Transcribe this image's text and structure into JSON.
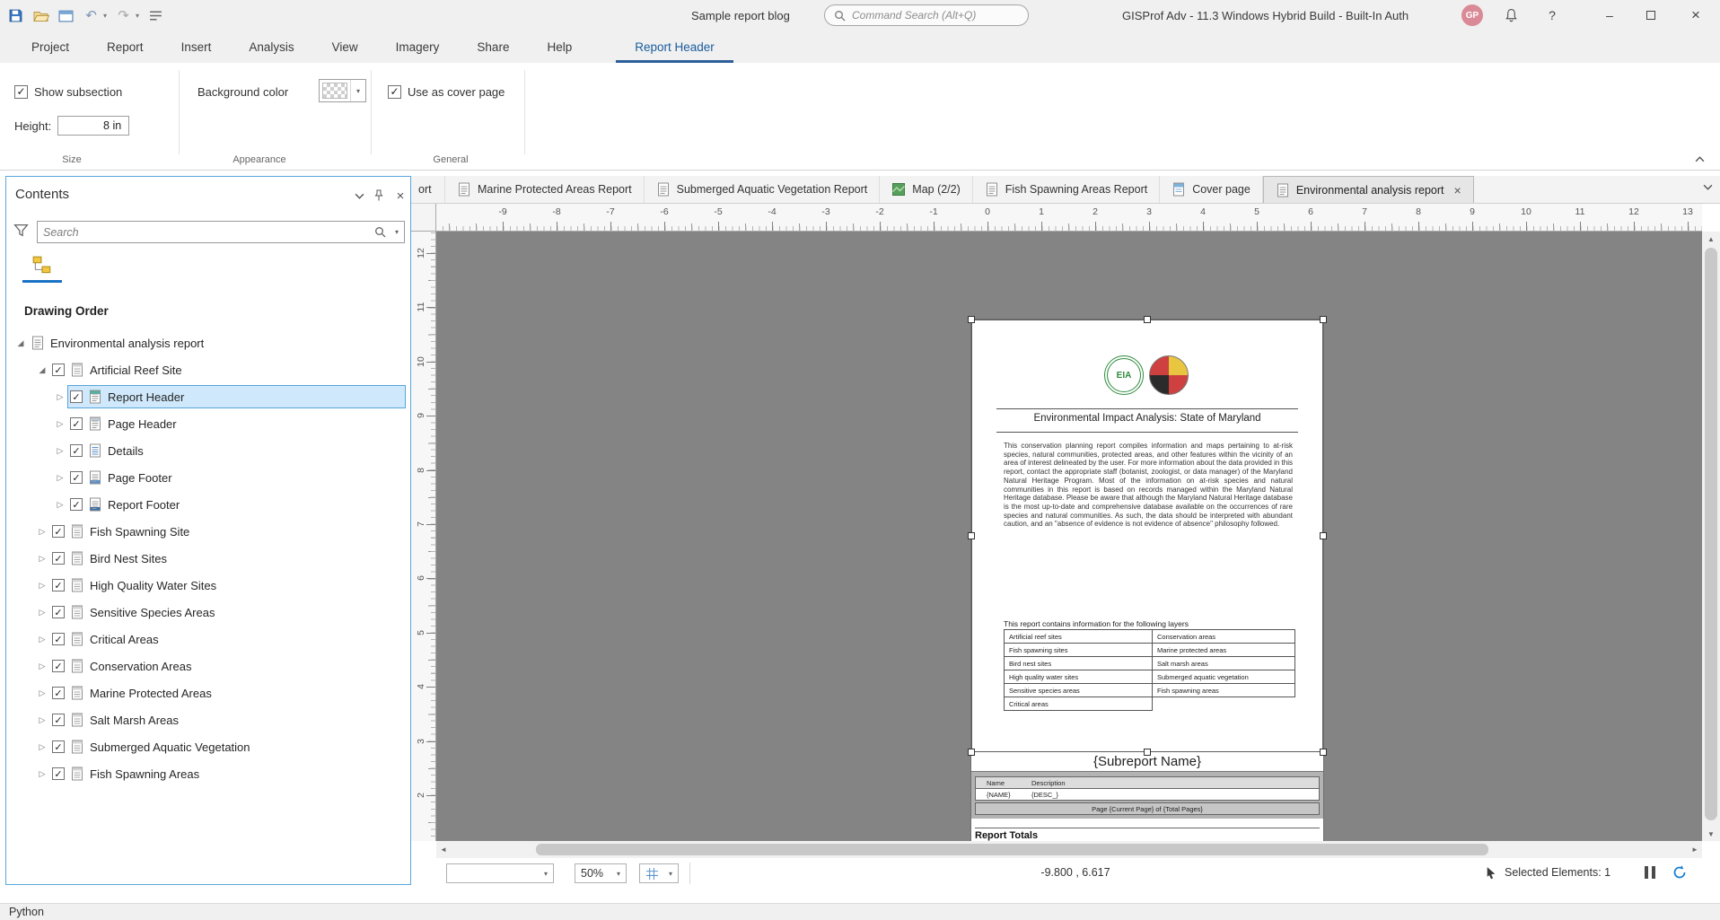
{
  "titlebar": {
    "project_name": "Sample report blog",
    "search_placeholder": "Command Search (Alt+Q)",
    "app_title": "GISProf Adv - 11.3 Windows Hybrid Build - Built-In Auth",
    "avatar_initials": "GP"
  },
  "ribbon": {
    "tabs": [
      "Project",
      "Report",
      "Insert",
      "Analysis",
      "View",
      "Imagery",
      "Share",
      "Help"
    ],
    "contextual_tab": "Report Header",
    "size_group": {
      "show_subsection_label": "Show subsection",
      "height_label": "Height:",
      "height_value": "8 in",
      "group_label": "Size"
    },
    "appearance_group": {
      "background_color_label": "Background color",
      "group_label": "Appearance"
    },
    "general_group": {
      "use_as_cover_label": "Use as cover page",
      "group_label": "General"
    }
  },
  "contents_panel": {
    "title": "Contents",
    "search_placeholder": "Search",
    "section_title": "Drawing Order",
    "tree": [
      {
        "label": "Environmental analysis report",
        "level": 0,
        "expander": "expanded",
        "checked": null,
        "icon": "report",
        "selected": false
      },
      {
        "label": "Artificial Reef Site",
        "level": 1,
        "expander": "expanded",
        "checked": true,
        "icon": "section",
        "selected": false
      },
      {
        "label": "Report Header",
        "level": 2,
        "expander": "collapsed",
        "checked": true,
        "icon": "report-header",
        "selected": true
      },
      {
        "label": "Page Header",
        "level": 2,
        "expander": "collapsed",
        "checked": true,
        "icon": "page-header",
        "selected": false
      },
      {
        "label": "Details",
        "level": 2,
        "expander": "collapsed",
        "checked": true,
        "icon": "details",
        "selected": false
      },
      {
        "label": "Page Footer",
        "level": 2,
        "expander": "collapsed",
        "checked": true,
        "icon": "page-footer",
        "selected": false
      },
      {
        "label": "Report Footer",
        "level": 2,
        "expander": "collapsed",
        "checked": true,
        "icon": "report-footer",
        "selected": false
      },
      {
        "label": "Fish Spawning Site",
        "level": 1,
        "expander": "collapsed",
        "checked": true,
        "icon": "section",
        "selected": false
      },
      {
        "label": "Bird Nest Sites",
        "level": 1,
        "expander": "collapsed",
        "checked": true,
        "icon": "section",
        "selected": false
      },
      {
        "label": "High Quality Water Sites",
        "level": 1,
        "expander": "collapsed",
        "checked": true,
        "icon": "section",
        "selected": false
      },
      {
        "label": "Sensitive Species Areas",
        "level": 1,
        "expander": "collapsed",
        "checked": true,
        "icon": "section",
        "selected": false
      },
      {
        "label": "Critical Areas",
        "level": 1,
        "expander": "collapsed",
        "checked": true,
        "icon": "section",
        "selected": false
      },
      {
        "label": "Conservation Areas",
        "level": 1,
        "expander": "collapsed",
        "checked": true,
        "icon": "section",
        "selected": false
      },
      {
        "label": "Marine Protected Areas",
        "level": 1,
        "expander": "collapsed",
        "checked": true,
        "icon": "section",
        "selected": false
      },
      {
        "label": "Salt Marsh Areas",
        "level": 1,
        "expander": "collapsed",
        "checked": true,
        "icon": "section",
        "selected": false
      },
      {
        "label": "Submerged Aquatic Vegetation",
        "level": 1,
        "expander": "collapsed",
        "checked": true,
        "icon": "section",
        "selected": false
      },
      {
        "label": "Fish Spawning Areas",
        "level": 1,
        "expander": "collapsed",
        "checked": true,
        "icon": "section",
        "selected": false
      }
    ]
  },
  "doc_tabs": [
    {
      "label": "ort",
      "icon": "report",
      "partial": true,
      "active": false,
      "closable": false
    },
    {
      "label": "Marine Protected Areas Report",
      "icon": "report",
      "partial": false,
      "active": false,
      "closable": false
    },
    {
      "label": "Submerged Aquatic Vegetation Report",
      "icon": "report",
      "partial": false,
      "active": false,
      "closable": false
    },
    {
      "label": "Map (2/2)",
      "icon": "map",
      "partial": false,
      "active": false,
      "closable": false
    },
    {
      "label": "Fish Spawning Areas Report",
      "icon": "report",
      "partial": false,
      "active": false,
      "closable": false
    },
    {
      "label": "Cover page",
      "icon": "cover",
      "partial": false,
      "active": false,
      "closable": false
    },
    {
      "label": "Environmental analysis report",
      "icon": "report",
      "partial": false,
      "active": true,
      "closable": true
    }
  ],
  "rulers": {
    "horizontal": [
      -9,
      -8,
      -7,
      -6,
      -5,
      -4,
      -3,
      -2,
      -1,
      0,
      1,
      2,
      3,
      4,
      5,
      6,
      7,
      8,
      9,
      10,
      11,
      12,
      13
    ],
    "vertical": [
      12,
      11,
      10,
      9,
      8,
      7,
      6,
      5,
      4,
      3,
      2
    ]
  },
  "report_page": {
    "eia_logo_text": "EIA",
    "title": "Environmental Impact Analysis: State of Maryland",
    "body": "This conservation planning report compiles information and maps pertaining to at-risk species, natural communities, protected areas, and other features within the vicinity of an area of interest delineated by the user. For more information about the data provided in this report, contact the appropriate staff (botanist, zoologist, or data manager) of the Maryland Natural Heritage Program. Most of the information on at-risk species and natural communities in this report is based on records managed within the Maryland Natural Heritage database. Please be aware that although the Maryland Natural Heritage database is the most up-to-date and comprehensive database available on the occurrences of rare species and natural communities. As such, the data should be interpreted with abundant caution, and an \"absence of evidence is not evidence of absence\" philosophy followed.",
    "layers_intro": "This report contains information for the following layers",
    "layers_table": {
      "left": [
        "Artificial reef sites",
        "Fish spawning sites",
        "Bird nest sites",
        "High quality water sites",
        "Sensitive species areas",
        "Critical areas"
      ],
      "right": [
        "Conservation areas",
        "Marine protected areas",
        "Salt marsh areas",
        "Submerged aquatic vegetation",
        "Fish spawning areas"
      ]
    },
    "subreport_name": "{Subreport Name}",
    "table_header": {
      "name": "Name",
      "description": "Description"
    },
    "table_row": {
      "name": "{NAME}",
      "description": "{DESC_}"
    },
    "page_note": "Page {Current Page} of {Total Pages}",
    "report_totals": "Report Totals"
  },
  "layout_statusbar": {
    "zoom": "50%",
    "coordinates": "-9.800 , 6.617",
    "selected_elements": "Selected Elements: 1"
  },
  "app_statusbar": {
    "label": "Python"
  },
  "colors": {
    "accent_blue": "#1a72c4",
    "contextual_tab": "#2d5f9a",
    "selection_fill": "#cfe8fb",
    "selection_border": "#56a4da",
    "canvas_gray": "#848484",
    "avatar_pink": "#d98a96",
    "map_icon_green": "#57a05c",
    "eia_green": "#2e8b3e"
  }
}
